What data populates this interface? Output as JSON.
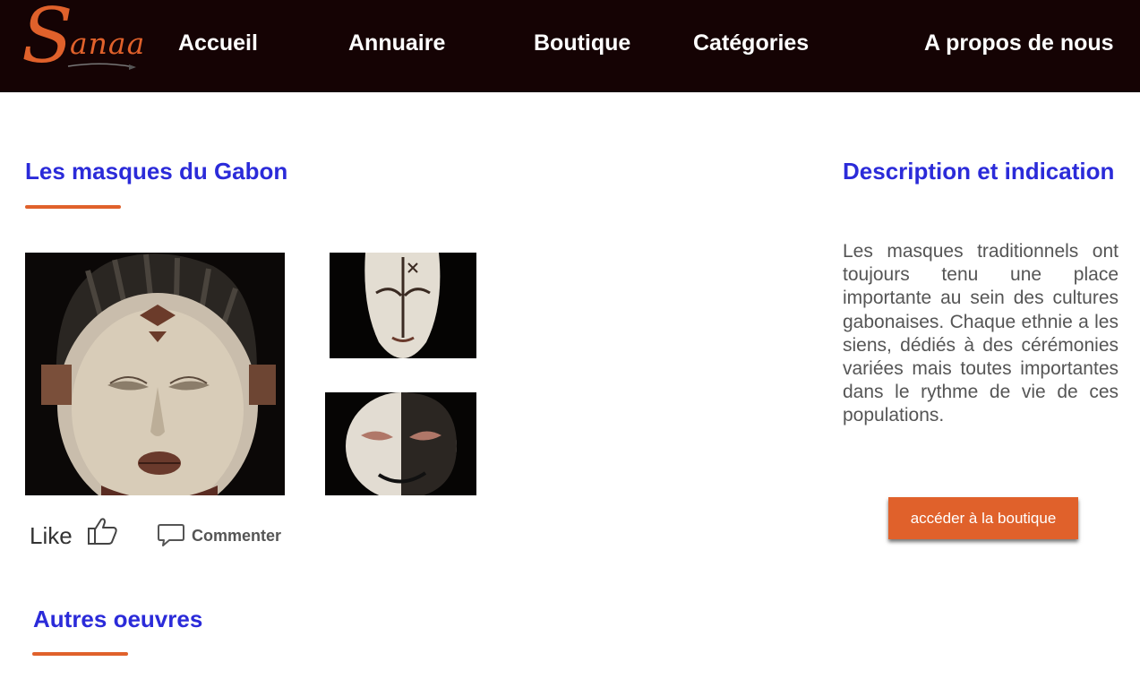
{
  "header": {
    "logo_text": "Sanaa",
    "nav": [
      "Accueil",
      "Annuaire",
      "Boutique",
      "Catégories",
      "A propos de nous"
    ]
  },
  "gallery": {
    "title": "Les masques du Gabon",
    "like_label": "Like",
    "comment_label": "Commenter"
  },
  "description": {
    "title": "Description et indication",
    "text": "Les masques traditionnels ont toujours tenu une place importante au sein des cultures gabonaises. Chaque ethnie a les siens, dédiés à des cérémonies variées mais toutes importantes dans le rythme de vie de ces populations.",
    "button_label": "accéder à la boutique"
  },
  "others": {
    "title": "Autres oeuvres"
  },
  "colors": {
    "header_bg": "#150304",
    "accent": "#e0612b",
    "title_blue": "#2b2bd9"
  }
}
